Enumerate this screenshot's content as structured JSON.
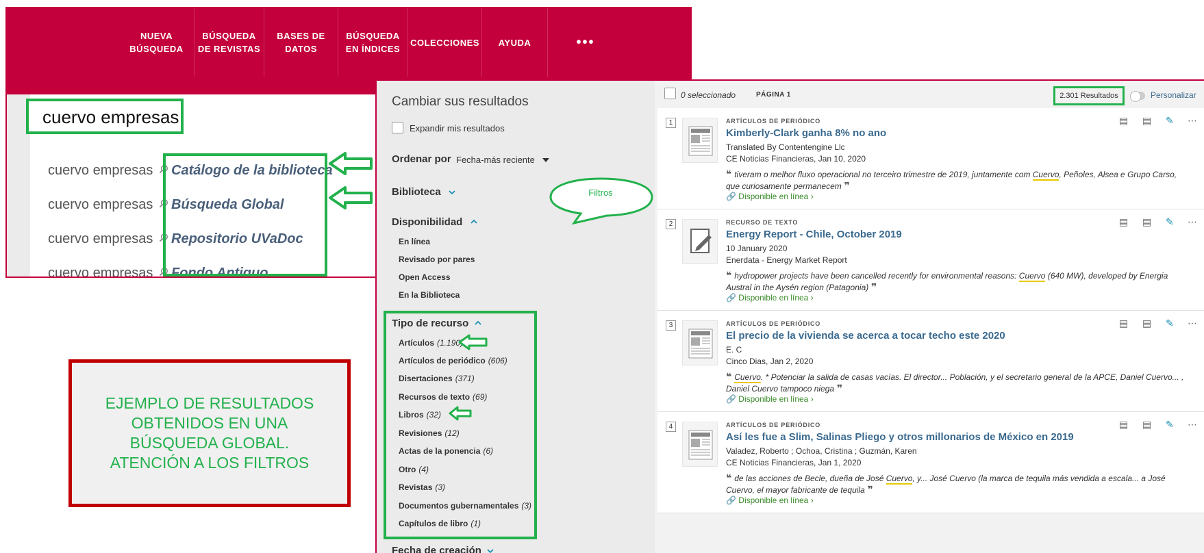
{
  "nav": {
    "items": [
      "NUEVA\nBÚSQUEDA",
      "BÚSQUEDA\nDE REVISTAS",
      "BASES DE\nDATOS",
      "BÚSQUEDA\nEN ÍNDICES",
      "COLECCIONES",
      "AYUDA"
    ],
    "more": "•••"
  },
  "search": {
    "value": "cuervo empresas",
    "suggestions": [
      {
        "query": "cuervo empresas",
        "scope": "Catálogo de la biblioteca"
      },
      {
        "query": "cuervo empresas",
        "scope": "Búsqueda Global"
      },
      {
        "query": "cuervo empresas",
        "scope": "Repositorio UVaDoc"
      },
      {
        "query": "cuervo empresas",
        "scope": "Fondo Antiguo"
      }
    ]
  },
  "annotations": {
    "example_text": "EJEMPLO DE RESULTADOS\nOBTENIDOS EN UNA\nBÚSQUEDA GLOBAL.\nATENCIÓN A LOS FILTROS",
    "filters_bubble": "Filtros"
  },
  "facets": {
    "title": "Cambiar sus resultados",
    "expand": "Expandir mis resultados",
    "sort_label": "Ordenar por",
    "sort_value": "Fecha-más reciente",
    "library": "Biblioteca",
    "availability": "Disponibilidad",
    "availability_items": [
      "En línea",
      "Revisado por pares",
      "Open Access",
      "En la Biblioteca"
    ],
    "resource_type": "Tipo de recurso",
    "resource_items": [
      {
        "label": "Artículos",
        "count": "(1.190)"
      },
      {
        "label": "Artículos de periódico",
        "count": "(606)"
      },
      {
        "label": "Disertaciones",
        "count": "(371)"
      },
      {
        "label": "Recursos de texto",
        "count": "(69)"
      },
      {
        "label": "Libros",
        "count": "(32)"
      },
      {
        "label": "Revisiones",
        "count": "(12)"
      },
      {
        "label": "Actas de la ponencia",
        "count": "(6)"
      },
      {
        "label": "Otro",
        "count": "(4)"
      },
      {
        "label": "Revistas",
        "count": "(3)"
      },
      {
        "label": "Documentos gubernamentales",
        "count": "(3)"
      },
      {
        "label": "Capítulos de libro",
        "count": "(1)"
      }
    ],
    "creation_date": "Fecha de creación"
  },
  "toolbar": {
    "selected": "0 seleccionado",
    "page": "PÁGINA 1",
    "count": "2.301 Resultados",
    "customize": "Personalizar"
  },
  "results": [
    {
      "num": "1",
      "type": "ARTÍCULOS DE PERIÓDICO",
      "title": "Kimberly-Clark ganha 8% no ano",
      "line1": "Translated By Contentengine Llc",
      "line2": "CE Noticias Financieras, Jan 10, 2020",
      "snippet_pre": "tiveram o melhor fluxo operacional no terceiro trimestre de 2019, juntamente com ",
      "snippet_mark": "Cuervo",
      "snippet_post": ", Peñoles, Alsea e Grupo Carso, que curiosamente permanecem",
      "availability": "Disponible en línea",
      "thumb": "newspaper-icon"
    },
    {
      "num": "2",
      "type": "RECURSO DE TEXTO",
      "title": "Energy Report - Chile, October 2019",
      "line1": "10 January 2020",
      "line2": "Enerdata - Energy Market Report",
      "snippet_pre": "hydropower projects have been cancelled recently for environmental reasons: ",
      "snippet_mark": "Cuervo",
      "snippet_post": " (640 MW), developed by Energia Austral in the Aysén region (Patagonia)",
      "availability": "Disponible en línea",
      "thumb": "text-resource-icon"
    },
    {
      "num": "3",
      "type": "ARTÍCULOS DE PERIÓDICO",
      "title": "El precio de la vivienda se acerca a tocar techo este 2020",
      "line1": "E. C",
      "line2": "Cinco Dias, Jan 2, 2020",
      "snippet_pre": "",
      "snippet_mark": "Cuervo",
      "snippet_post": ". * Potenciar la salida de casas vacías. El director... Población, y el secretario general de la APCE, Daniel Cuervo... , Daniel Cuervo tampoco niega",
      "availability": "Disponible en línea",
      "thumb": "newspaper-icon"
    },
    {
      "num": "4",
      "type": "ARTÍCULOS DE PERIÓDICO",
      "title": "Así les fue a Slim, Salinas Pliego y otros millonarios de México en 2019",
      "line1": "Valadez, Roberto ; Ochoa, Cristina ; Guzmán, Karen",
      "line2": "CE Noticias Financieras, Jan 1, 2020",
      "snippet_pre": "de las acciones de Becle, dueña de José ",
      "snippet_mark": "Cuervo",
      "snippet_post": ", y... José Cuervo (la marca de tequila más vendida a escala... a José Cuervo, el mayor fabricante de tequila",
      "availability": "Disponible en línea",
      "thumb": "newspaper-icon"
    }
  ],
  "colors": {
    "brand": "#c4003c",
    "annotation_green": "#22b14c",
    "link": "#3b6a8f",
    "available": "#3a8a2a"
  }
}
